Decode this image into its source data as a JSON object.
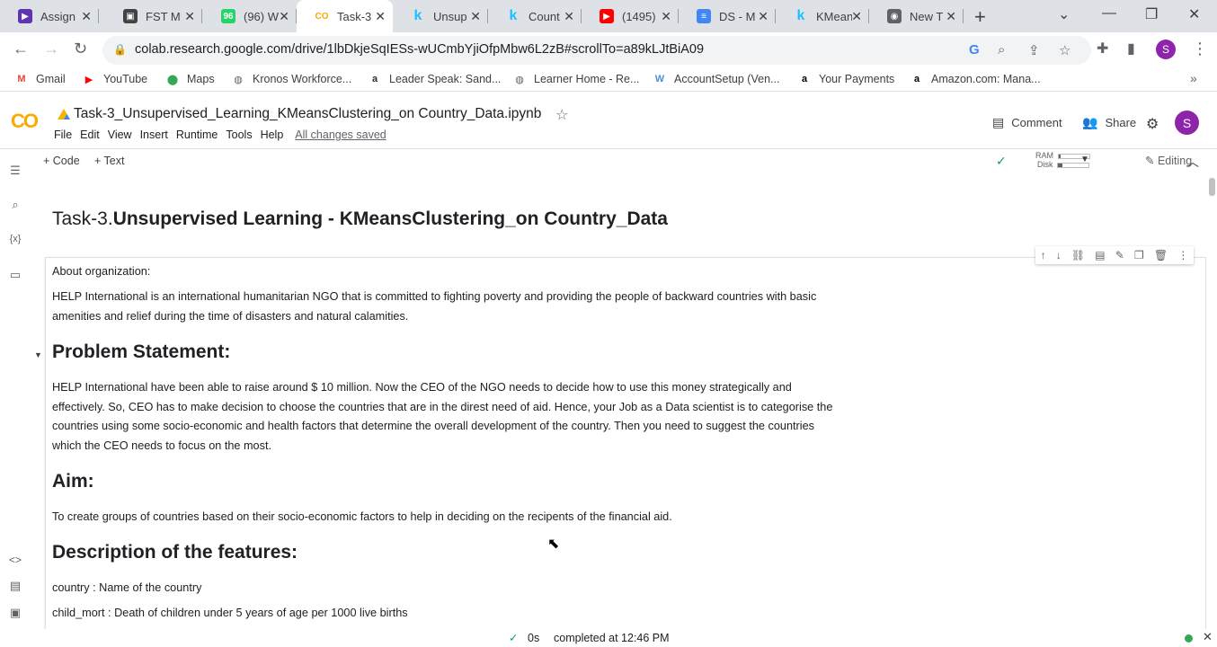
{
  "browser": {
    "tabs": [
      {
        "label": "Assign",
        "icon": "assignment-icon",
        "color": "#5e35b1",
        "glyph": "▶"
      },
      {
        "label": "FST MI",
        "icon": "slides-icon",
        "color": "#424242",
        "glyph": "▣"
      },
      {
        "label": "(96) W",
        "icon": "whatsapp-icon",
        "color": "#25d366",
        "glyph": "96"
      },
      {
        "label": "Task-3",
        "icon": "colab-icon",
        "color": "#f9ab00",
        "glyph": "CO",
        "active": true
      },
      {
        "label": "Unsup",
        "icon": "kaggle-icon",
        "color": "#20beff",
        "glyph": "k"
      },
      {
        "label": "Count",
        "icon": "kaggle-icon",
        "color": "#20beff",
        "glyph": "k"
      },
      {
        "label": "(1495)",
        "icon": "youtube-icon",
        "color": "#ff0000",
        "glyph": "▶"
      },
      {
        "label": "DS - M",
        "icon": "docs-icon",
        "color": "#4285f4",
        "glyph": "≡"
      },
      {
        "label": "KMean",
        "icon": "kaggle-icon",
        "color": "#20beff",
        "glyph": "k"
      },
      {
        "label": "New T",
        "icon": "chrome-icon",
        "color": "#5f6368",
        "glyph": "◉"
      }
    ],
    "url": "colab.research.google.com/drive/1lbDkjeSqIESs-wUCmbYjiOfpMbw6L2zB#scrollTo=a89kLJtBiA09",
    "profile_initial": "S"
  },
  "bookmarks": [
    {
      "label": "Gmail",
      "icon": "gmail-icon",
      "glyph": "M",
      "color": "#ea4335"
    },
    {
      "label": "YouTube",
      "icon": "youtube-icon",
      "glyph": "▶",
      "color": "#ff0000"
    },
    {
      "label": "Maps",
      "icon": "maps-icon",
      "glyph": "⬤",
      "color": "#34a853"
    },
    {
      "label": "Kronos Workforce...",
      "icon": "globe-icon",
      "glyph": "◍",
      "color": "#5f6368"
    },
    {
      "label": "Leader Speak: Sand...",
      "icon": "amazon-icon",
      "glyph": "a",
      "color": "#232f3e"
    },
    {
      "label": "Learner Home - Re...",
      "icon": "globe-icon",
      "glyph": "◍",
      "color": "#5f6368"
    },
    {
      "label": "AccountSetup (Ven...",
      "icon": "w-icon",
      "glyph": "W",
      "color": "#4a90d9"
    },
    {
      "label": "Your Payments",
      "icon": "amazon-icon",
      "glyph": "a",
      "color": "#000000"
    },
    {
      "label": "Amazon.com: Mana...",
      "icon": "amazon-icon",
      "glyph": "a",
      "color": "#000000"
    }
  ],
  "colab": {
    "logo": "CO",
    "notebook_title": "Task-3_Unsupervised_Learning_KMeansClustering_on Country_Data.ipynb",
    "menu": [
      "File",
      "Edit",
      "View",
      "Insert",
      "Runtime",
      "Tools",
      "Help"
    ],
    "saved_status": "All changes saved",
    "comment_label": "Comment",
    "share_label": "Share",
    "add_code_label": "Code",
    "add_text_label": "Text",
    "ram_label": "RAM",
    "disk_label": "Disk",
    "ram_fraction": 0.08,
    "disk_fraction": 0.15,
    "editing_label": "Editing"
  },
  "notebook": {
    "title_prefix": "Task-3.",
    "title_bold": "Unsupervised Learning - KMeansClustering_on Country_Data",
    "about_heading": "About organization:",
    "about_text": "HELP International is an international humanitarian NGO that is committed to fighting poverty and providing the people of backward countries with basic amenities and relief during the time of disasters and natural calamities.",
    "problem_heading": "Problem Statement:",
    "problem_text": "HELP International have been able to raise around $ 10 million. Now the CEO of the NGO needs to decide how to use this money strategically and effectively. So, CEO has to make decision to choose the countries that are in the direst need of aid. Hence, your Job as a Data scientist is to categorise the countries using some socio-economic and health factors that determine the overall development of the country. Then you need to suggest the countries which the CEO needs to focus on the most.",
    "aim_heading": "Aim:",
    "aim_text": "To create groups of countries based on their socio-economic factors to help in deciding on the recipents of the financial aid.",
    "features_heading": "Description of the features:",
    "feature_1": "country : Name of the country",
    "feature_2": "child_mort : Death of children under 5 years of age per 1000 live births"
  },
  "status": {
    "elapsed": "0s",
    "completed": "completed at 12:46 PM"
  }
}
